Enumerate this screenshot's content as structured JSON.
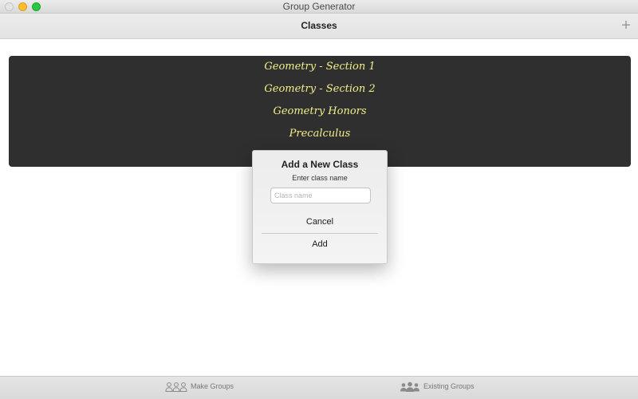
{
  "window": {
    "title": "Group Generator"
  },
  "navbar": {
    "title": "Classes",
    "add_button": "+"
  },
  "classes": [
    "Geometry - Section 1",
    "Geometry - Section 2",
    "Geometry Honors",
    "Precalculus"
  ],
  "dialog": {
    "title": "Add a New Class",
    "message": "Enter class name",
    "input_value": "",
    "input_placeholder": "Class name",
    "cancel_label": "Cancel",
    "add_label": "Add"
  },
  "tabbar": {
    "tabs": [
      {
        "label": "Make Groups",
        "icon": "group-outline-icon"
      },
      {
        "label": "Existing Groups",
        "icon": "group-filled-icon"
      }
    ]
  },
  "colors": {
    "class_text": "#f3ef8a",
    "panel_bg": "#2f2f2f",
    "close_button": "#e4e4e4",
    "minimize_button": "#febc2e",
    "maximize_button": "#28c840"
  }
}
